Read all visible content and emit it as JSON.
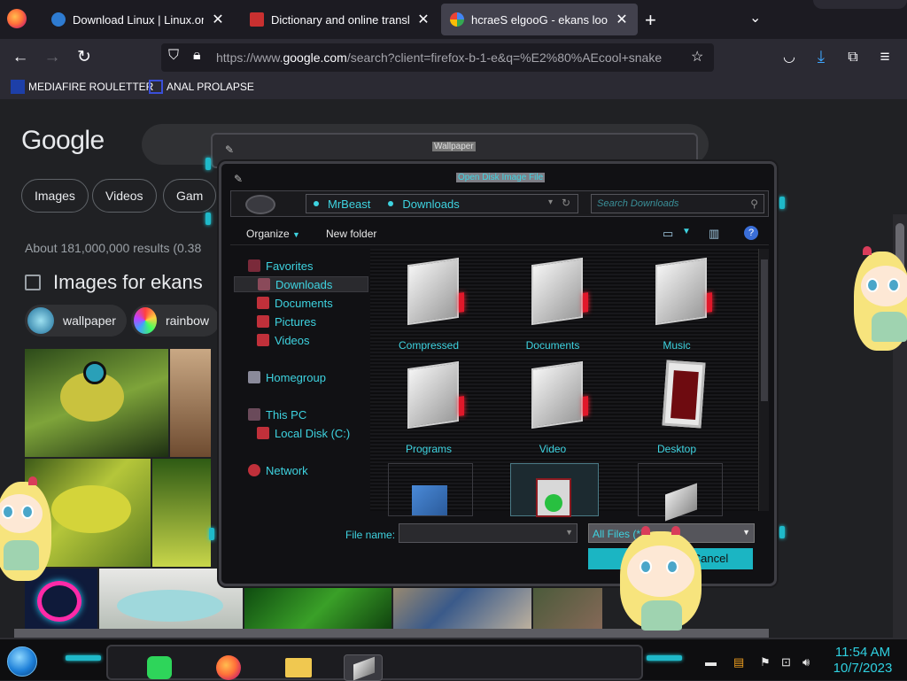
{
  "browser": {
    "tabs": [
      {
        "title": "Download Linux | Linux.org",
        "icon": "globe-icon",
        "active": false
      },
      {
        "title": "Dictionary and online translatio",
        "icon": "dictionary-icon",
        "active": false
      },
      {
        "title": "hcraeS elgooG - ekans looc",
        "icon": "google-icon",
        "active": true
      }
    ],
    "new_tab": "+",
    "url_prefix": "https://www.",
    "url_host": "google.com",
    "url_rest": "/search?client=firefox-b-1-e&q=%E2%80%AEcool+snake",
    "bookmarks": [
      {
        "label": "MEDIAFIRE ROULETTER",
        "icon": "mediafire-icon"
      },
      {
        "label": "ANAL PROLAPSE",
        "icon": "bookmark-icon"
      }
    ]
  },
  "google": {
    "logo": "Google",
    "chips": [
      "Images",
      "Videos",
      "Gam"
    ],
    "results_count": "About 181,000,000 results (0.38",
    "images_heading": "Images for ekans",
    "pills": [
      "wallpaper",
      "rainbow"
    ]
  },
  "dialog": {
    "back_title": "Wallpaper",
    "title": "Open Disk Image File",
    "breadcrumbs": [
      "MrBeast",
      "Downloads"
    ],
    "search_placeholder": "Search Downloads",
    "toolbar": {
      "organize": "Organize",
      "new_folder": "New folder",
      "help": "?"
    },
    "nav": {
      "favorites": "Favorites",
      "downloads": "Downloads",
      "documents": "Documents",
      "pictures": "Pictures",
      "videos": "Videos",
      "homegroup": "Homegroup",
      "this_pc": "This PC",
      "local_disk": "Local Disk (C:)",
      "network": "Network"
    },
    "folders": [
      "Compressed",
      "Documents",
      "Music",
      "Programs",
      "Video",
      "Desktop"
    ],
    "file_name_label": "File name:",
    "file_name_value": "",
    "file_type": "All Files (*)",
    "cancel": "Cancel"
  },
  "taskbar": {
    "time": "11:54 AM",
    "date": "10/7/2023",
    "apps": [
      "notes-app-icon",
      "firefox-icon",
      "file-explorer-icon",
      "settings-tool-icon"
    ]
  },
  "colors": {
    "accent": "#3ed3e0",
    "background": "#202124",
    "dialog_bg": "#111114"
  }
}
